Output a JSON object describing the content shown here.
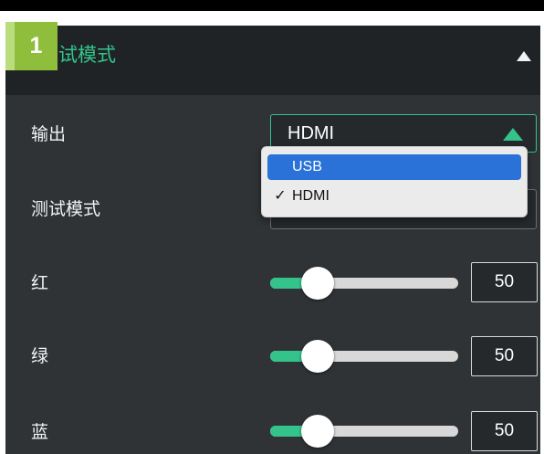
{
  "colors": {
    "accent": "#34c48b",
    "panel_background": "#2f3336",
    "header_background": "#1f2326",
    "badge": "#8fbe3c",
    "selection": "#2a72d8"
  },
  "badge": {
    "number": "1"
  },
  "header": {
    "title": "试模式",
    "collapse_icon": "triangle-up-icon"
  },
  "output": {
    "label": "输出",
    "value": "HDMI",
    "arrow_icon": "triangle-up-icon",
    "dropdown": {
      "options": [
        {
          "label": "USB",
          "highlighted": true,
          "checked": false
        },
        {
          "label": "HDMI",
          "highlighted": false,
          "checked": true
        }
      ],
      "check_mark": "✓"
    }
  },
  "test_mode": {
    "label": "测试模式"
  },
  "sliders": [
    {
      "label": "红",
      "value": "50",
      "level": 0.25
    },
    {
      "label": "绿",
      "value": "50",
      "level": 0.25
    },
    {
      "label": "蓝",
      "value": "50",
      "level": 0.25
    }
  ]
}
